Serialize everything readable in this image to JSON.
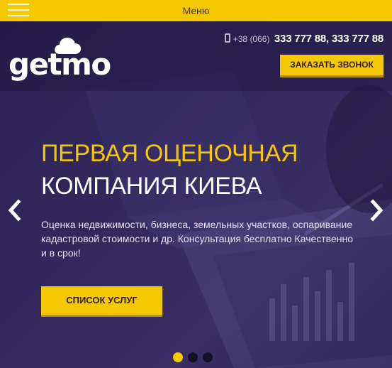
{
  "topbar": {
    "menu_label": "Меню",
    "hamburger_icon": "menu-icon",
    "color": "#f5c800"
  },
  "header": {
    "logo_text": "getmo",
    "logo_icon": "cloud-icon",
    "phone_icon": "phone-icon",
    "phone_prefix": "+38 (066)",
    "phone_numbers": "333 777 88, 333 777 88",
    "callback_label": "ЗАКАЗАТЬ ЗВОНОК"
  },
  "hero": {
    "title_line1": "ПЕРВАЯ ОЦЕНОЧНАЯ",
    "title_line2": "КОМПАНИЯ КИЕВА",
    "description": "Оценка недвижимости, бизнеса, земельных участков, оспаривание кадастровой стоимости и др. Консультация бесплатно Качественно и в срок!",
    "services_label": "СПИСОК УСЛУГ",
    "prev_icon": "chevron-left-icon",
    "next_icon": "chevron-right-icon",
    "slides": [
      "slide-1",
      "slide-2",
      "slide-3"
    ],
    "active_slide": 1
  },
  "colors": {
    "accent": "#f5c800",
    "hero_bg": "#2c2152",
    "text_light": "#ffffff"
  }
}
